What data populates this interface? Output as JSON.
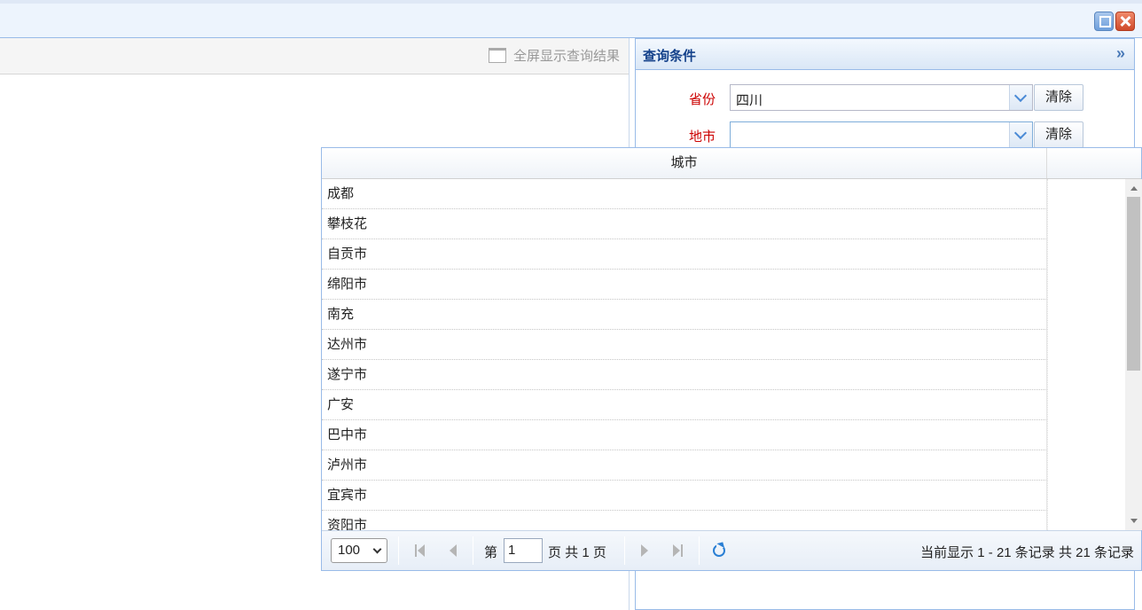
{
  "window": {
    "restore_icon": "restore-icon",
    "close_icon": "close-icon"
  },
  "left": {
    "fullscreen_label": "全屏显示查询结果"
  },
  "right": {
    "title": "查询条件",
    "collapse_icon": "»",
    "province_label": "省份",
    "province_value": "四川",
    "city_label": "地市",
    "city_value": "",
    "clear_label": "清除"
  },
  "dropdown": {
    "column_title": "城市",
    "rows": [
      "成都",
      "攀枝花",
      "自贡市",
      "绵阳市",
      "南充",
      "达州市",
      "遂宁市",
      "广安",
      "巴中市",
      "泸州市",
      "宜宾市",
      "资阳市"
    ],
    "pager": {
      "page_size": "100",
      "page_prefix": "第",
      "page_value": "1",
      "page_suffix": "页 共 1 页",
      "display_info": "当前显示 1 - 21 条记录 共 21 条记录"
    }
  },
  "colors": {
    "accent": "#15428b",
    "required_label": "#cc0000",
    "border": "#99bbe8"
  }
}
